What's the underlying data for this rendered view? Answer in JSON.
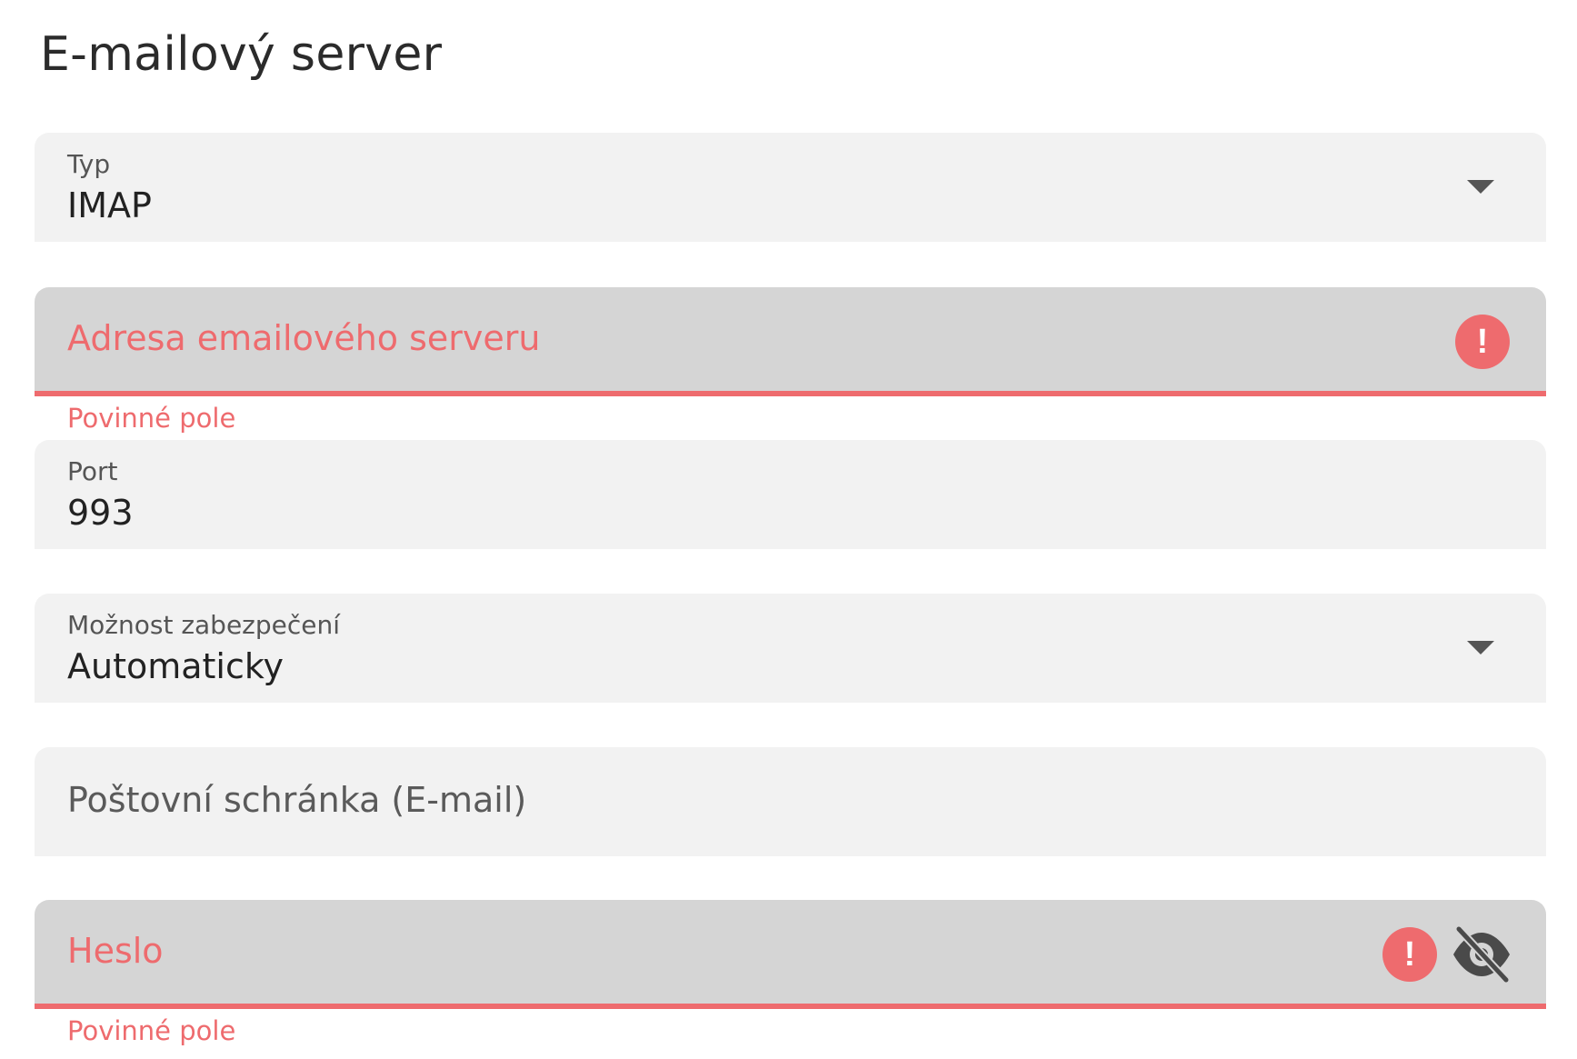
{
  "page": {
    "title": "E-mailový server"
  },
  "fields": {
    "type": {
      "label": "Typ",
      "value": "IMAP"
    },
    "server_address": {
      "placeholder": "Adresa emailového serveru",
      "helper": "Povinné pole"
    },
    "port": {
      "label": "Port",
      "value": "993"
    },
    "security": {
      "label": "Možnost zabezpečení",
      "value": "Automaticky"
    },
    "mailbox": {
      "placeholder": "Poštovní schránka (E-mail)"
    },
    "password": {
      "placeholder": "Heslo",
      "helper": "Povinné pole"
    }
  },
  "icons": {
    "error": "!",
    "error_icon_name": "error-icon",
    "visibility_icon_name": "eye-off-icon",
    "dropdown_icon_name": "chevron-down-icon"
  },
  "colors": {
    "error": "#ee6b6e",
    "field_bg": "#f2f2f2",
    "field_error_bg": "#d5d5d5"
  }
}
